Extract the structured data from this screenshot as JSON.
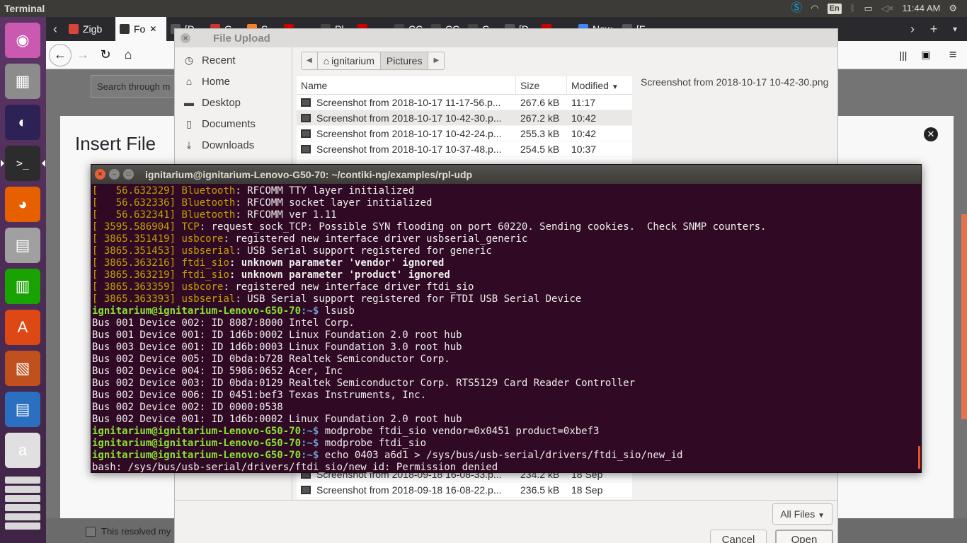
{
  "top_panel": {
    "app_title": "Terminal",
    "keyboard_layout": "En",
    "clock": "11:44 AM"
  },
  "launcher": {
    "items": [
      {
        "name": "ubuntu-dash",
        "glyph": "◉",
        "color": "#c95ab0"
      },
      {
        "name": "cube-app",
        "glyph": "▦",
        "color": "#8c8c8c"
      },
      {
        "name": "eclipse",
        "glyph": "◐",
        "color": "#2c2255"
      },
      {
        "name": "terminal",
        "glyph": ">_",
        "color": "#2c2c2c"
      },
      {
        "name": "firefox",
        "glyph": "◕",
        "color": "#e66000"
      },
      {
        "name": "files",
        "glyph": "▤",
        "color": "#a0a0a0"
      },
      {
        "name": "calc",
        "glyph": "▥",
        "color": "#18a303"
      },
      {
        "name": "software-center",
        "glyph": "A",
        "color": "#dd4814"
      },
      {
        "name": "impress",
        "glyph": "▧",
        "color": "#c0501e"
      },
      {
        "name": "writer",
        "glyph": "▤",
        "color": "#2a6fc0"
      },
      {
        "name": "amazon",
        "glyph": "a",
        "color": "#e0e0e0"
      }
    ]
  },
  "browser": {
    "tabs": [
      {
        "label": "Zigb",
        "color": "#d44638"
      },
      {
        "label": "Fo",
        "color": "#333333",
        "active": true
      },
      {
        "label": "[D",
        "color": "#555555"
      },
      {
        "label": "G",
        "color": "#cc3333"
      },
      {
        "label": "S",
        "color": "#f48024"
      },
      {
        "label": "",
        "color": "#cc0000"
      },
      {
        "label": "Pl",
        "color": "#444444"
      },
      {
        "label": "",
        "color": "#cc0000"
      },
      {
        "label": "CC",
        "color": "#444444"
      },
      {
        "label": "CC",
        "color": "#444444"
      },
      {
        "label": "C",
        "color": "#444444"
      },
      {
        "label": "[D",
        "color": "#555555"
      },
      {
        "label": "",
        "color": "#cc0000"
      },
      {
        "label": "New",
        "color": "#4285f4"
      },
      {
        "label": "[F",
        "color": "#555555"
      }
    ],
    "search_placeholder": "Search through m",
    "modal_title": "Insert File",
    "resolved_label": "This resolved my"
  },
  "file_dialog": {
    "title": "File Upload",
    "places": [
      {
        "label": "Recent",
        "icon": "◷"
      },
      {
        "label": "Home",
        "icon": "⌂"
      },
      {
        "label": "Desktop",
        "icon": "▬"
      },
      {
        "label": "Documents",
        "icon": "▯"
      },
      {
        "label": "Downloads",
        "icon": "⤓"
      }
    ],
    "path": [
      "ignitarium",
      "Pictures"
    ],
    "columns": {
      "name": "Name",
      "size": "Size",
      "modified": "Modified"
    },
    "files": [
      {
        "name": "Screenshot from 2018-10-17 11-17-56.p...",
        "size": "267.6 kB",
        "modified": "11:17"
      },
      {
        "name": "Screenshot from 2018-10-17 10-42-30.p...",
        "size": "267.2 kB",
        "modified": "10:42",
        "selected": true
      },
      {
        "name": "Screenshot from 2018-10-17 10-42-24.p...",
        "size": "255.3 kB",
        "modified": "10:42"
      },
      {
        "name": "Screenshot from 2018-10-17 10-37-48.p...",
        "size": "254.5 kB",
        "modified": "10:37"
      }
    ],
    "files_bottom": [
      {
        "name": "Screenshot from 2018-09-18 16-08-33.p...",
        "size": "234.2 kB",
        "modified": "18 Sep"
      },
      {
        "name": "Screenshot from 2018-09-18 16-08-22.p...",
        "size": "236.5 kB",
        "modified": "18 Sep"
      }
    ],
    "preview_name": "Screenshot from 2018-10-17 10-42-30.png",
    "filter": "All Files",
    "cancel": "Cancel",
    "open": "Open"
  },
  "terminal": {
    "title": "ignitarium@ignitarium-Lenovo-G50-70: ~/contiki-ng/examples/rpl-udp",
    "prompt_user": "ignitarium@ignitarium-Lenovo-G50-70",
    "prompt_path": ":~$",
    "kernel_lines": [
      {
        "ts": "[   56.632329]",
        "src": "Bluetooth",
        "msg": ": RFCOMM TTY layer initialized",
        "bold": false
      },
      {
        "ts": "[   56.632336]",
        "src": "Bluetooth",
        "msg": ": RFCOMM socket layer initialized",
        "bold": false
      },
      {
        "ts": "[   56.632341]",
        "src": "Bluetooth",
        "msg": ": RFCOMM ver 1.11",
        "bold": false
      },
      {
        "ts": "[ 3595.586904]",
        "src": "TCP",
        "msg": ": request_sock_TCP: Possible SYN flooding on port 60220. Sending cookies.  Check SNMP counters.",
        "bold": false
      },
      {
        "ts": "[ 3865.351419]",
        "src": "usbcore",
        "msg": ": registered new interface driver usbserial_generic",
        "bold": false
      },
      {
        "ts": "[ 3865.351453]",
        "src": "usbserial",
        "msg": ": USB Serial support registered for generic",
        "bold": false
      },
      {
        "ts": "[ 3865.363216]",
        "src": "ftdi_sio",
        "msg": ": unknown parameter 'vendor' ignored",
        "bold": true
      },
      {
        "ts": "[ 3865.363219]",
        "src": "ftdi_sio",
        "msg": ": unknown parameter 'product' ignored",
        "bold": true
      },
      {
        "ts": "[ 3865.363359]",
        "src": "usbcore",
        "msg": ": registered new interface driver ftdi_sio",
        "bold": false
      },
      {
        "ts": "[ 3865.363393]",
        "src": "usbserial",
        "msg": ": USB Serial support registered for FTDI USB Serial Device",
        "bold": false
      }
    ],
    "cmd_lsusb": " lsusb",
    "lsusb_output": [
      "Bus 001 Device 002: ID 8087:8000 Intel Corp.",
      "Bus 001 Device 001: ID 1d6b:0002 Linux Foundation 2.0 root hub",
      "Bus 003 Device 001: ID 1d6b:0003 Linux Foundation 3.0 root hub",
      "Bus 002 Device 005: ID 0bda:b728 Realtek Semiconductor Corp.",
      "Bus 002 Device 004: ID 5986:0652 Acer, Inc",
      "Bus 002 Device 003: ID 0bda:0129 Realtek Semiconductor Corp. RTS5129 Card Reader Controller",
      "Bus 002 Device 006: ID 0451:bef3 Texas Instruments, Inc.",
      "Bus 002 Device 002: ID 0000:0538",
      "Bus 002 Device 001: ID 1d6b:0002 Linux Foundation 2.0 root hub"
    ],
    "cmd_modprobe1": " modprobe ftdi_sio vendor=0x0451 product=0xbef3",
    "cmd_modprobe2": " modprobe ftdi_sio",
    "cmd_echo": " echo 0403 a6d1 > /sys/bus/usb-serial/drivers/ftdi_sio/new_id",
    "error_line": "bash: /sys/bus/usb-serial/drivers/ftdi_sio/new_id: Permission denied"
  }
}
